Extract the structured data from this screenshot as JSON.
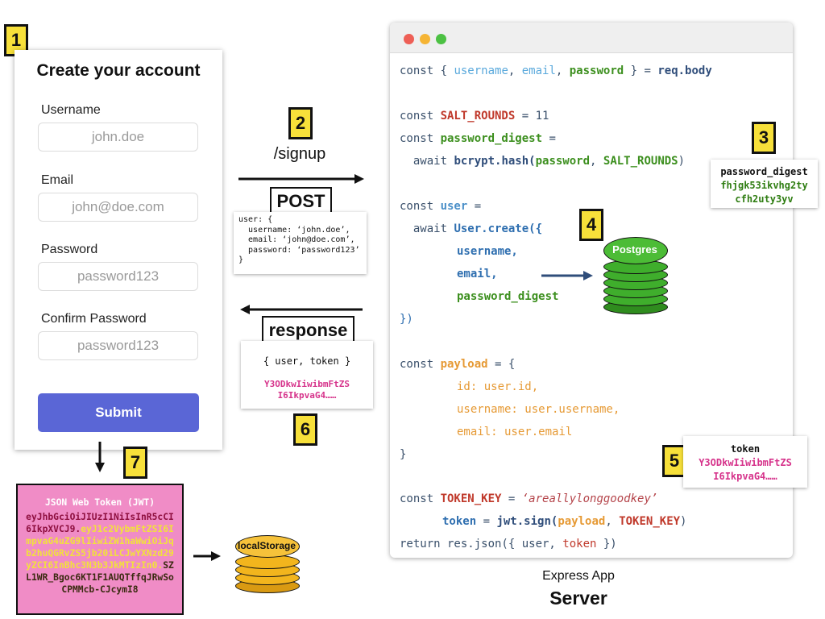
{
  "steps": [
    "1",
    "2",
    "3",
    "4",
    "5",
    "6",
    "7"
  ],
  "form": {
    "title": "Create your account",
    "username_label": "Username",
    "username_placeholder": "john.doe",
    "email_label": "Email",
    "email_placeholder": "john@doe.com",
    "password_label": "Password",
    "password_placeholder": "password123",
    "confirm_label": "Confirm Password",
    "confirm_placeholder": "password123",
    "submit_label": "Submit"
  },
  "request": {
    "route": "/signup",
    "method": "POST",
    "body_lines": [
      "user: {",
      "  username: ‘john.doe’,",
      "  email: ‘john@doe.com’,",
      "  password: ‘password123’",
      "}"
    ]
  },
  "response": {
    "label": "response",
    "body_title": "{ user, token }",
    "token_line1": "Y3ODkwIiwibmFtZS",
    "token_line2": "I6IkpvaG4……"
  },
  "jwt": {
    "title": "JSON Web Token (JWT)",
    "header": "eyJhbGciOiJIUzI1NiIsInR5cCI6IkpXVCJ9.",
    "payload": "eyJ1c2VybmFtZSI6ImpvaG4uZG9lIiwiZW1haWwiOiJqb2huQGRvZS5jb20iLCJwYXNzd29yZCI6InBhc3N3b3JkMTIzIn0.",
    "signature": "SZL1WR_Bgoc6KT1F1AUQTffqJRwSoCPMMcb-CJcymI8"
  },
  "local_storage": {
    "label": "localStorage"
  },
  "postgres": {
    "label": "Postgres"
  },
  "server": {
    "subtitle": "Express App",
    "title": "Server"
  },
  "code": {
    "l1": {
      "a": "const { ",
      "b": "username",
      "c": ", ",
      "d": "email",
      "e": ", ",
      "f": "password",
      "g": " } = ",
      "h": "req.body"
    },
    "l2": {
      "a": "const ",
      "b": "SALT_ROUNDS",
      "c": " = 11"
    },
    "l3": {
      "a": "const ",
      "b": "password_digest",
      "c": " ="
    },
    "l4": {
      "a": "  await ",
      "b": "bcrypt.hash(",
      "c": "password",
      "d": ", ",
      "e": "SALT_ROUNDS",
      "f": ")"
    },
    "l5": {
      "a": "const ",
      "b": "user",
      "c": " ="
    },
    "l6": {
      "a": "  await ",
      "b": "User.create({"
    },
    "l7": "username,",
    "l8": "email,",
    "l9": "password_digest",
    "l10": "})",
    "l11": {
      "a": "const ",
      "b": "payload",
      "c": " = {"
    },
    "l12": "id: user.id,",
    "l13": "username: user.username,",
    "l14": "email: user.email",
    "l15": "}",
    "l16": {
      "a": "const ",
      "b": "TOKEN_KEY",
      "c": " = ",
      "d": "‘areallylonggoodkey’"
    },
    "l17": {
      "a": "token",
      "b": " = ",
      "c": "jwt.sign(",
      "d": "payload",
      "e": ", ",
      "f": "TOKEN_KEY",
      "g": ")"
    },
    "l18": {
      "a": "return res.json({ user, ",
      "b": "token",
      "c": " })"
    }
  },
  "digest_callout": {
    "title": "password_digest",
    "line1": "fhjgk53ikvhg2ty",
    "line2": "cfh2uty3yv"
  },
  "token_callout": {
    "title": "token",
    "line1": "Y3ODkwIiwibmFtZS",
    "line2": "I6IkpvaG4……"
  },
  "colors": {
    "badge": "#f7e03a",
    "submit": "#5a66d6",
    "jwt_bg": "#f08cc6",
    "postgres_green": "#3fae2c",
    "local_storage_gold": "#f2b51d",
    "token_pink": "#d6338b",
    "digest_green": "#2f7d12"
  },
  "icons": [
    "arrow-right-icon",
    "arrow-left-icon",
    "arrow-down-icon",
    "database-icon",
    "window-close-dot",
    "window-minimize-dot",
    "window-maximize-dot"
  ]
}
